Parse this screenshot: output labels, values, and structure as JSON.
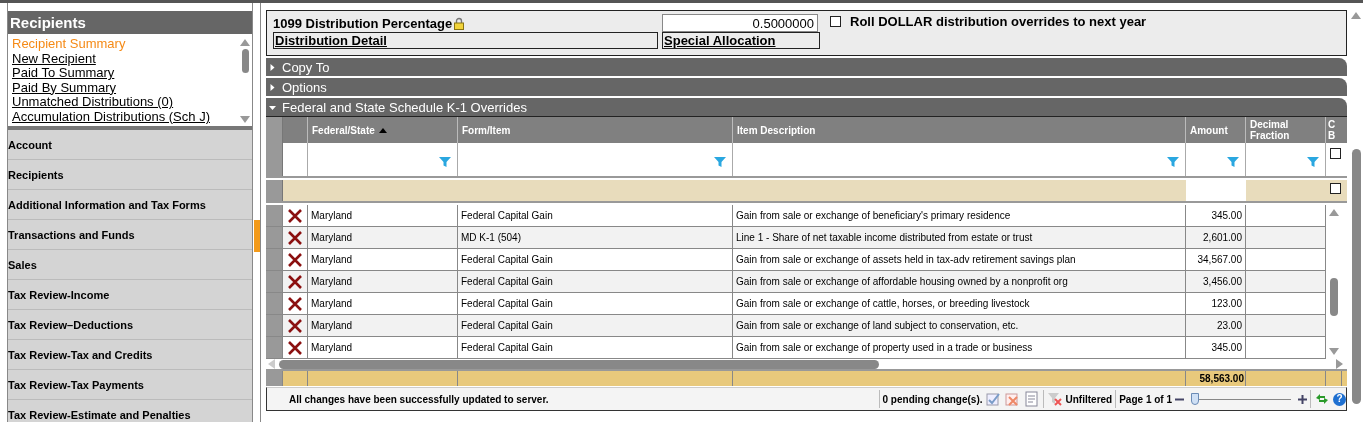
{
  "sidebar": {
    "title": "Recipients",
    "links": [
      {
        "label": "Recipient Summary",
        "selected": true
      },
      {
        "label": "New Recipient",
        "selected": false
      },
      {
        "label": "Paid To Summary",
        "selected": false
      },
      {
        "label": "Paid By Summary",
        "selected": false
      },
      {
        "label": "Unmatched Distributions (0)",
        "selected": false
      },
      {
        "label": "Accumulation Distributions (Sch J)",
        "selected": false
      }
    ],
    "nav_items": [
      "Account",
      "Recipients",
      "Additional Information and Tax Forms",
      "Transactions and Funds",
      "Sales",
      "Tax Review-Income",
      "Tax Review–Deductions",
      "Tax Review-Tax and Credits",
      "Tax Review-Tax Payments",
      "Tax Review-Estimate and Penalties"
    ]
  },
  "form": {
    "percentage_label": "1099 Distribution Percentage",
    "locked": true,
    "percentage_value": "0.5000000",
    "roll_over": {
      "label": "Roll DOLLAR distribution overrides to next year",
      "checked": false
    },
    "links": [
      "Distribution Detail",
      "Special Allocation"
    ]
  },
  "sections": [
    {
      "title": "Copy To",
      "expanded": false
    },
    {
      "title": "Options",
      "expanded": false
    },
    {
      "title": "Federal and State Schedule K-1 Overrides",
      "expanded": true
    }
  ],
  "grid": {
    "columns": [
      {
        "label": "Federal/State",
        "sorted": true,
        "filter": {
          "kind": "funnel"
        }
      },
      {
        "label": "Form/Item",
        "sorted": false,
        "filter": {
          "kind": "funnel"
        }
      },
      {
        "label": "Item Description",
        "sorted": false,
        "filter": {
          "kind": "funnel"
        }
      },
      {
        "label": "Amount",
        "sorted": false,
        "filter": {
          "kind": "funnel"
        }
      },
      {
        "label": "Decimal Fraction",
        "sorted": false,
        "filter": {
          "kind": "funnel"
        }
      },
      {
        "label": "C B",
        "sorted": false,
        "filter": {
          "kind": "checkbox",
          "checked": false
        }
      }
    ],
    "new_row": {
      "checked": false
    },
    "rows": [
      {
        "federal_state": "Maryland",
        "form_item": "Federal Capital Gain",
        "item_description": "Gain from sale or exchange of beneficiary's primary residence",
        "amount": "345.00"
      },
      {
        "federal_state": "Maryland",
        "form_item": "MD K-1 (504)",
        "item_description": "Line 1 - Share of net taxable income distributed from estate or trust",
        "amount": "2,601.00"
      },
      {
        "federal_state": "Maryland",
        "form_item": "Federal Capital Gain",
        "item_description": "Gain from sale or exchange of assets held in tax-adv retirement savings plan",
        "amount": "34,567.00"
      },
      {
        "federal_state": "Maryland",
        "form_item": "Federal Capital Gain",
        "item_description": "Gain from sale or exchange of affordable housing owned by a nonprofit org",
        "amount": "3,456.00"
      },
      {
        "federal_state": "Maryland",
        "form_item": "Federal Capital Gain",
        "item_description": "Gain from sale or exchange of cattle, horses, or breeding livestock",
        "amount": "123.00"
      },
      {
        "federal_state": "Maryland",
        "form_item": "Federal Capital Gain",
        "item_description": "Gain from sale or exchange of land subject to conservation, etc.",
        "amount": "23.00"
      },
      {
        "federal_state": "Maryland",
        "form_item": "Federal Capital Gain",
        "item_description": "Gain from sale or exchange of property used in a trade or business",
        "amount": "345.00"
      }
    ],
    "total_amount": "58,563.00"
  },
  "status_bar": {
    "message": "All changes have been successfully updated to server.",
    "pending": "0 pending change(s).",
    "filter_state": "Unfiltered",
    "page": "Page 1 of 1",
    "page_slider": {
      "level": 0
    },
    "help": "?"
  }
}
